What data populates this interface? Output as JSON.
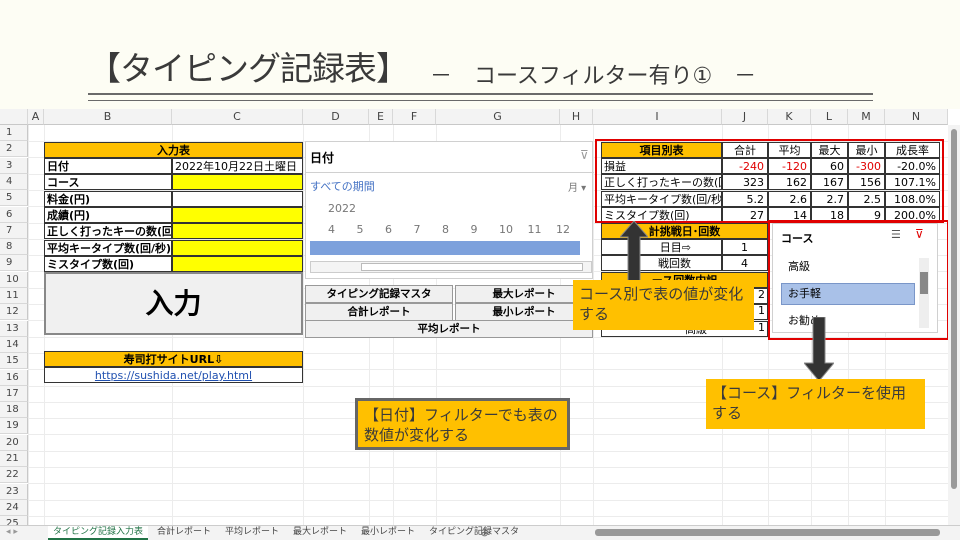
{
  "slide": {
    "title": "【タイピング記録表】",
    "subtitle": "－　コースフィルター有り①　－"
  },
  "columns": [
    "A",
    "B",
    "C",
    "D",
    "E",
    "F",
    "G",
    "H",
    "I",
    "J",
    "K",
    "L",
    "M",
    "N"
  ],
  "rows": [
    "1",
    "2",
    "3",
    "4",
    "5",
    "6",
    "7",
    "8",
    "9",
    "10",
    "11",
    "12",
    "13",
    "14",
    "15",
    "16",
    "17",
    "18",
    "19",
    "20",
    "21",
    "22",
    "23",
    "24",
    "25"
  ],
  "input_table": {
    "header": "入力表",
    "rows": [
      {
        "label": "日付",
        "value": "2022年10月22日土曜日"
      },
      {
        "label": "コース",
        "value": ""
      },
      {
        "label": "料金(円)",
        "value": ""
      },
      {
        "label": "成績(円)",
        "value": ""
      },
      {
        "label": "正しく打ったキーの数(回)",
        "value": ""
      },
      {
        "label": "平均キータイプ数(回/秒)",
        "value": ""
      },
      {
        "label": "ミスタイプ数(回)",
        "value": ""
      }
    ],
    "button": "入力"
  },
  "sushi": {
    "header": "寿司打サイトURL⇩",
    "url": "https://sushida.net/play.html"
  },
  "date_slicer": {
    "title": "日付",
    "period": "すべての期間",
    "unit": "月",
    "year": "2022",
    "months": [
      "4",
      "5",
      "6",
      "7",
      "8",
      "9",
      "10",
      "11",
      "12"
    ]
  },
  "nav_buttons": {
    "master": "タイピング記録マスタ",
    "max": "最大レポート",
    "total": "合計レポート",
    "min": "最小レポート",
    "avg": "平均レポート"
  },
  "item_table": {
    "headers": [
      "項目別表",
      "合計",
      "平均",
      "最大",
      "最小",
      "成長率"
    ],
    "rows": [
      [
        "損益",
        "-240",
        "-120",
        "60",
        "-300",
        "-20.0%"
      ],
      [
        "正しく打ったキーの数(回)",
        "323",
        "162",
        "167",
        "156",
        "107.1%"
      ],
      [
        "平均キータイプ数(回/秒)",
        "5.2",
        "2.6",
        "2.7",
        "2.5",
        "108.0%"
      ],
      [
        "ミスタイプ数(回)",
        "27",
        "14",
        "18",
        "9",
        "200.0%"
      ]
    ]
  },
  "challenge_table": {
    "header": "計挑戦日･回数",
    "rows": [
      {
        "label": "日目⇨",
        "value": "1"
      },
      {
        "label": "戦回数",
        "value": "4"
      }
    ],
    "header2": "ース回数内訳",
    "rows2": [
      {
        "label": "",
        "value": "2"
      },
      {
        "label": "",
        "value": "1"
      },
      {
        "label": "高級",
        "value": "1"
      }
    ]
  },
  "course_slicer": {
    "title": "コース",
    "items": [
      "高級",
      "お手軽",
      "お勧め"
    ],
    "selected": "お手軽"
  },
  "callouts": {
    "course_value": "コース別で表の値が変化する",
    "course_filter": "【コース】フィルターを使用する",
    "date_filter": "【日付】フィルターでも表の数値が変化する"
  },
  "sheet_tabs": [
    "タイピング記録入力表",
    "合計レポート",
    "平均レポート",
    "最大レポート",
    "最小レポート",
    "タイピング記録マスタ"
  ],
  "colors": {
    "orange": "#ffc000",
    "yellow": "#ffff00",
    "red": "#e00000",
    "selected": "#a9c1e8"
  }
}
